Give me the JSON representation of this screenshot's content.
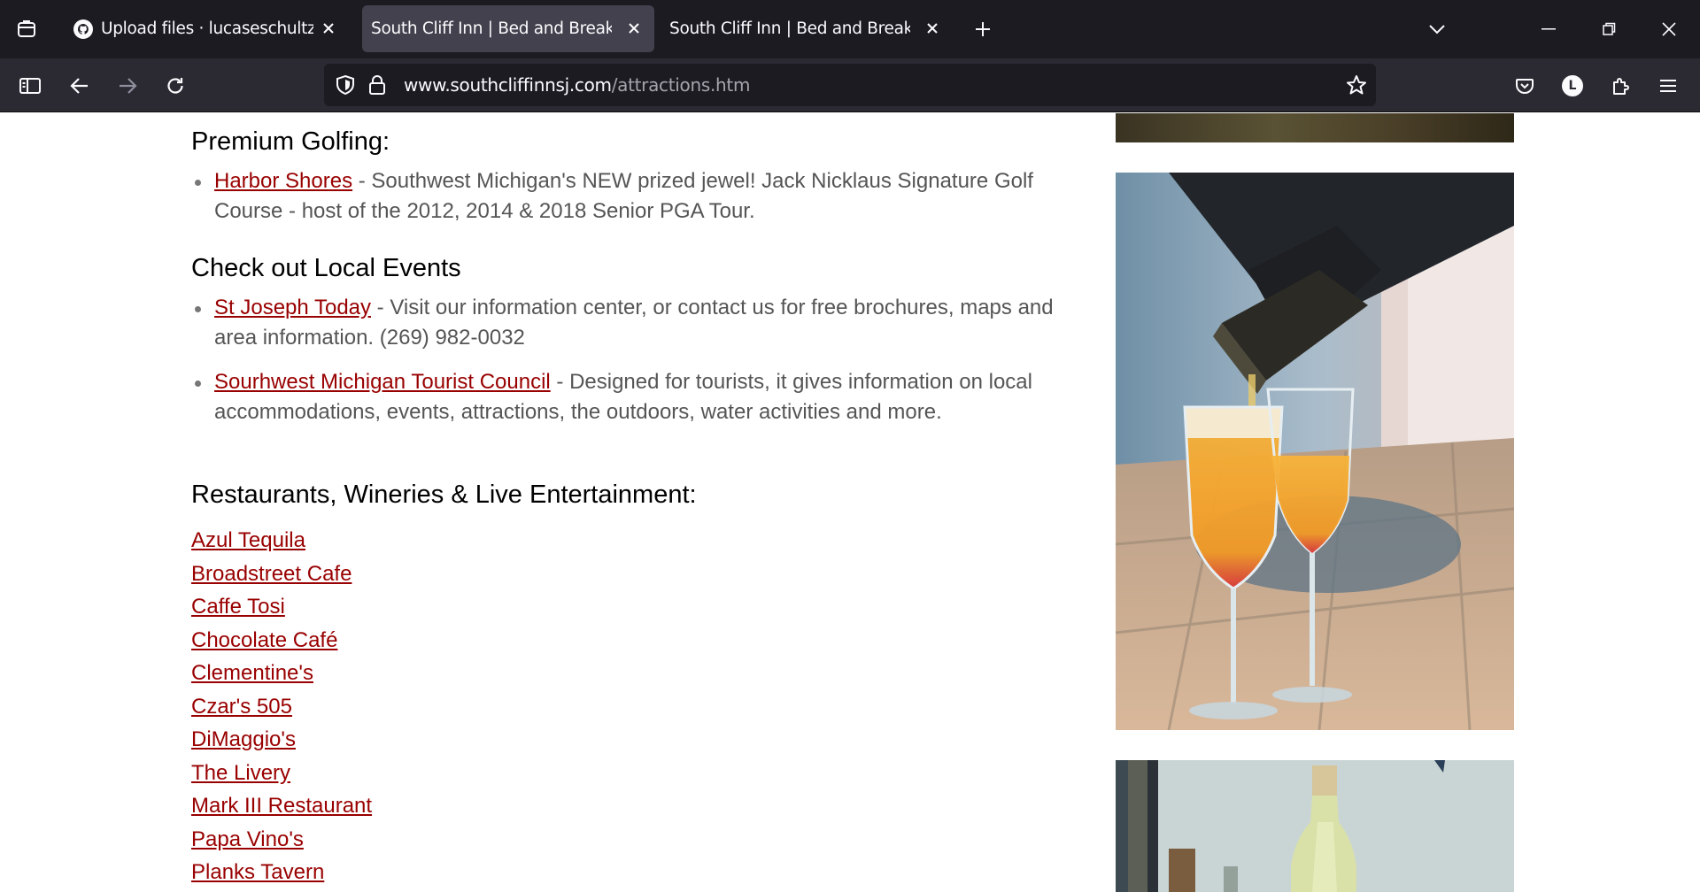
{
  "browser": {
    "tabs": [
      {
        "title": "Upload files · lucaseschultz/HTT",
        "active": false
      },
      {
        "title": "South Cliff Inn | Bed and Breakfast |",
        "active": true
      },
      {
        "title": "South Cliff Inn | Bed and Breakfast |",
        "active": false
      }
    ],
    "url_domain": "www.southcliffinnsj.com",
    "url_path": "/attractions.htm",
    "profile_initial": "L"
  },
  "page": {
    "golf": {
      "heading": "Premium Golfing:",
      "items": [
        {
          "link": "Harbor Shores",
          "text": " - Southwest Michigan's NEW prized jewel! Jack Nicklaus Signature Golf Course - host of the 2012, 2014 & 2018 Senior PGA Tour."
        }
      ]
    },
    "events": {
      "heading": "Check out Local Events",
      "items": [
        {
          "link": "St Joseph Today",
          "text": " - Visit our information center, or contact us for free brochures, maps and area information. (269) 982-0032"
        },
        {
          "link": "Sourhwest Michigan Tourist Council",
          "text": " - Designed for tourists, it gives information on local accommodations, events, attractions, the outdoors, water activities and more."
        }
      ]
    },
    "restaurants": {
      "heading": "Restaurants, Wineries & Live Entertainment:",
      "links": [
        "Azul Tequila",
        "Broadstreet Cafe",
        "Caffe Tosi",
        "Chocolate Café",
        "Clementine's",
        "Czar's 505",
        "DiMaggio's",
        "The Livery",
        "Mark III Restaurant",
        "Papa Vino's",
        "Planks Tavern"
      ]
    }
  },
  "colors": {
    "link": "#990000",
    "body_text": "#555555",
    "tabbar": "#1c1b22",
    "navbar": "#2b2a33"
  }
}
